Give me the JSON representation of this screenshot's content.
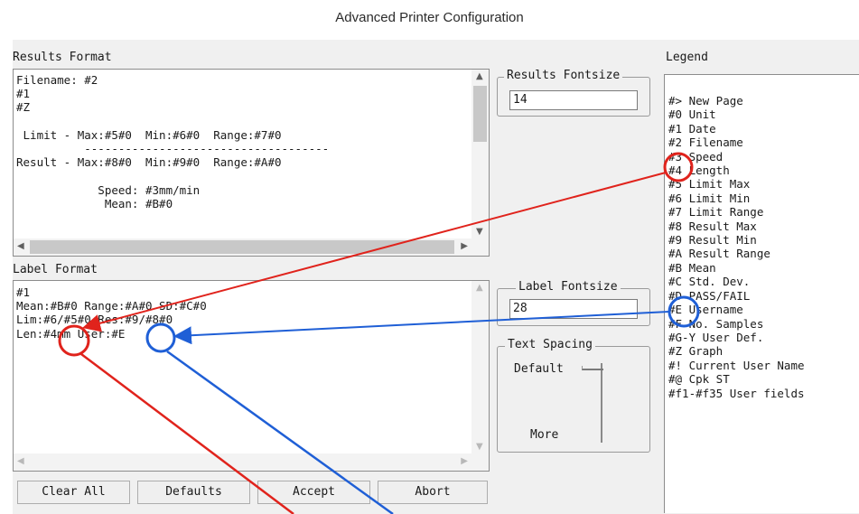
{
  "window": {
    "title": "Advanced Printer Configuration"
  },
  "results_format": {
    "label": "Results Format",
    "lines": [
      "Filename: #2",
      "#1",
      "#Z",
      "",
      " Limit - Max:#5#0  Min:#6#0  Range:#7#0",
      "          ------------------------------------",
      "Result - Max:#8#0  Min:#9#0  Range:#A#0",
      "",
      "            Speed: #3mm/min",
      "             Mean: #B#0"
    ]
  },
  "label_format": {
    "label": "Label Format",
    "lines": [
      "#1",
      "Mean:#B#0 Range:#A#0 SD:#C#0",
      "Lim:#6/#5#0 Res:#9/#8#0",
      "Len:#4mm User:#E"
    ]
  },
  "results_fontsize": {
    "label": "Results Fontsize",
    "value": "14"
  },
  "label_fontsize": {
    "label": "Label Fontsize",
    "value": "28"
  },
  "text_spacing": {
    "label": "Text Spacing",
    "default_label": "Default",
    "more_label": "More"
  },
  "legend": {
    "label": "Legend",
    "items": [
      "#> New Page",
      "#0 Unit",
      "#1 Date",
      "#2 Filename",
      "#3 Speed",
      "#4 Length",
      "#5 Limit Max",
      "#6 Limit Min",
      "#7 Limit Range",
      "#8 Result Max",
      "#9 Result Min",
      "#A Result Range",
      "#B Mean",
      "#C Std. Dev.",
      "#D PASS/FAIL",
      "#E Username",
      "#F No. Samples",
      "#G-Y User Def.",
      "#Z Graph",
      "#! Current User Name",
      "#@ Cpk ST",
      "#f1-#f35 User fields"
    ]
  },
  "buttons": {
    "clear_all": "Clear All",
    "defaults": "Defaults",
    "accept": "Accept",
    "abort": "Abort"
  },
  "annotation_colors": {
    "red": "#e0231c",
    "blue": "#1f5fd6"
  }
}
